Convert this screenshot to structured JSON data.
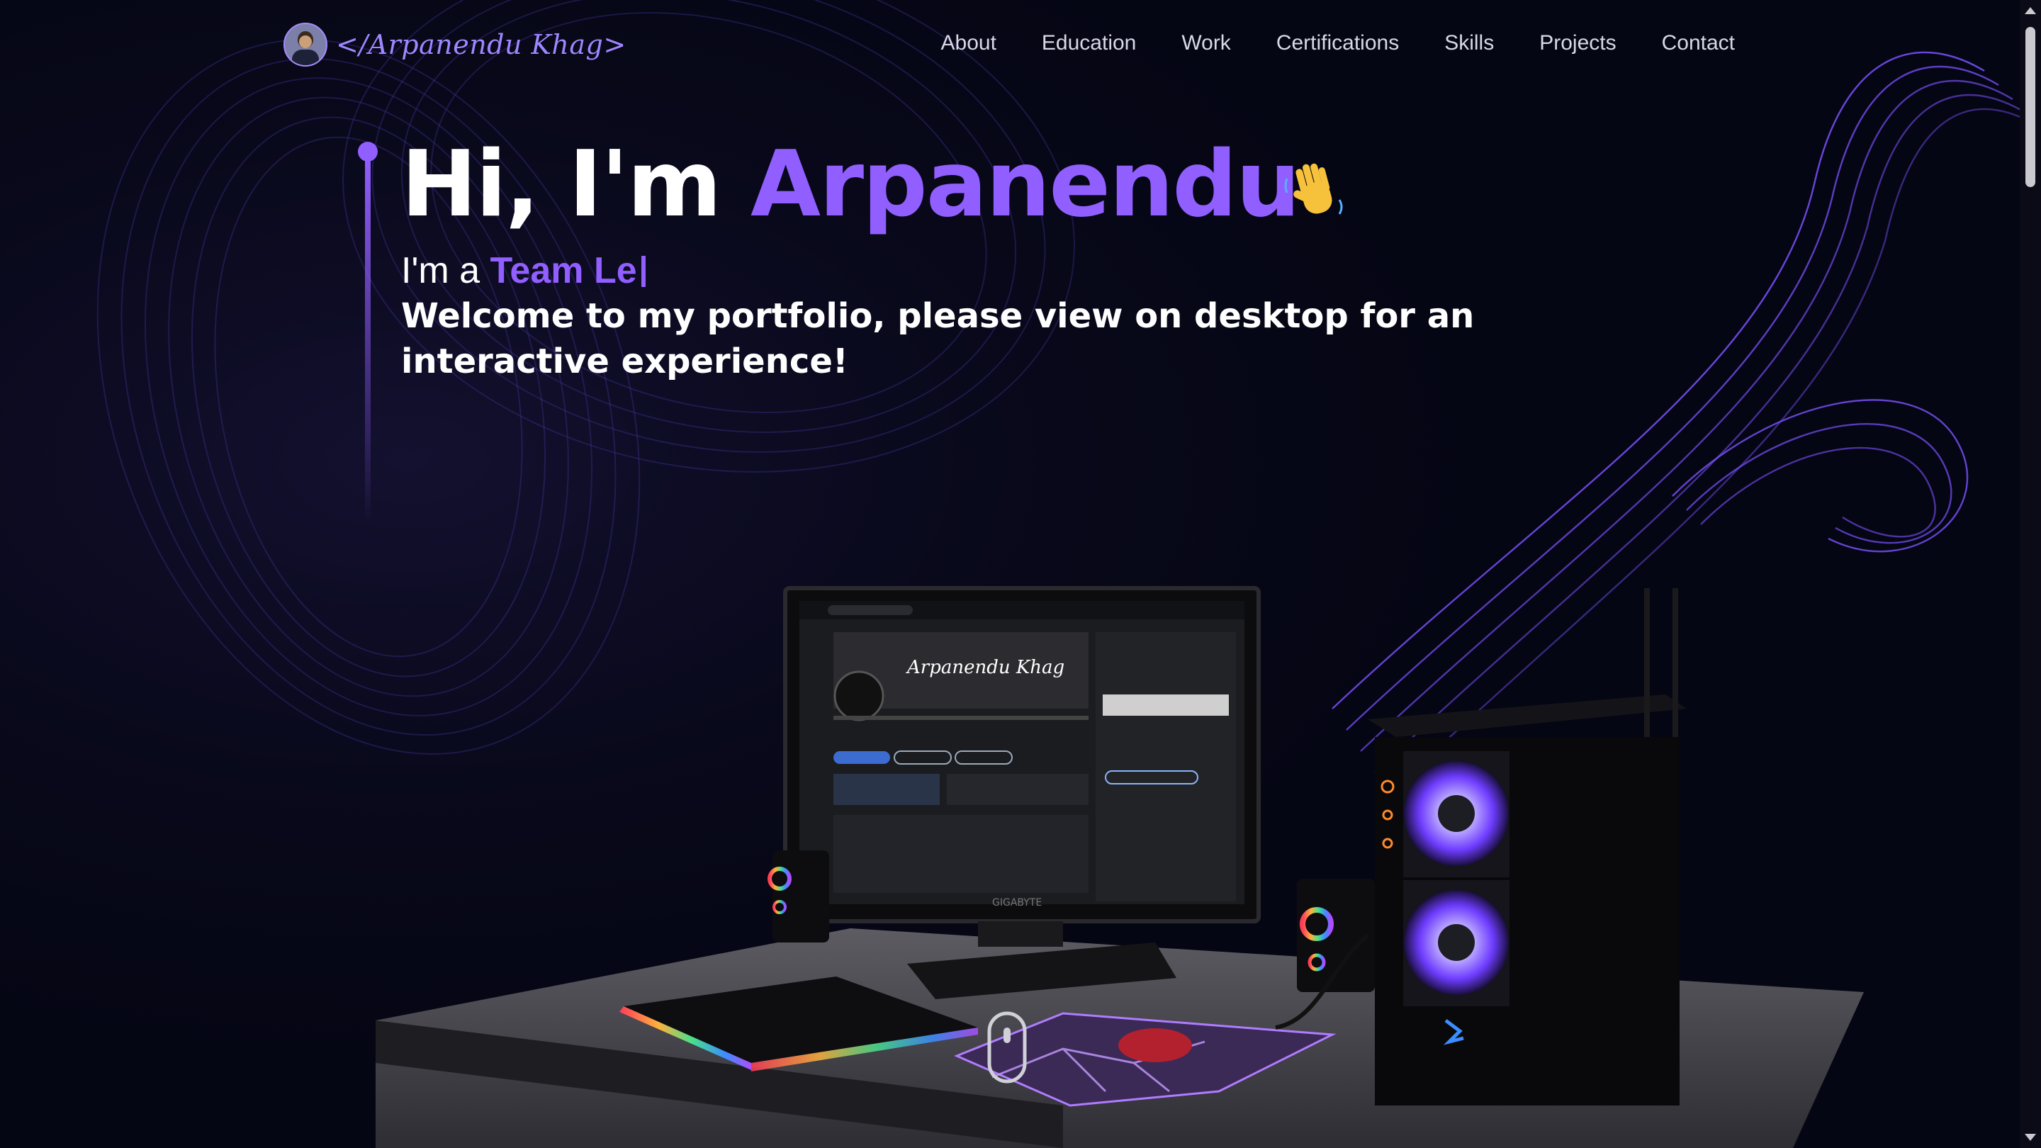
{
  "brand": {
    "logo_text": "</Arpanendu Khag>"
  },
  "nav": {
    "links": [
      "About",
      "Education",
      "Work",
      "Certifications",
      "Skills",
      "Projects",
      "Contact"
    ]
  },
  "hero": {
    "greeting": "Hi, I'm ",
    "name": "Arpanendu",
    "wave_icon": "waving-hand-icon",
    "role_prefix": "I'm a ",
    "role_typed": "Team Le",
    "welcome": "Welcome to my portfolio, please view on desktop for an interactive experience!"
  },
  "scene": {
    "monitor_brand": "GIGABYTE",
    "screen_profile_name": "Arpanendu Khag"
  },
  "colors": {
    "accent": "#915eff",
    "background": "#050614",
    "nav_text": "#d8d8e6"
  }
}
